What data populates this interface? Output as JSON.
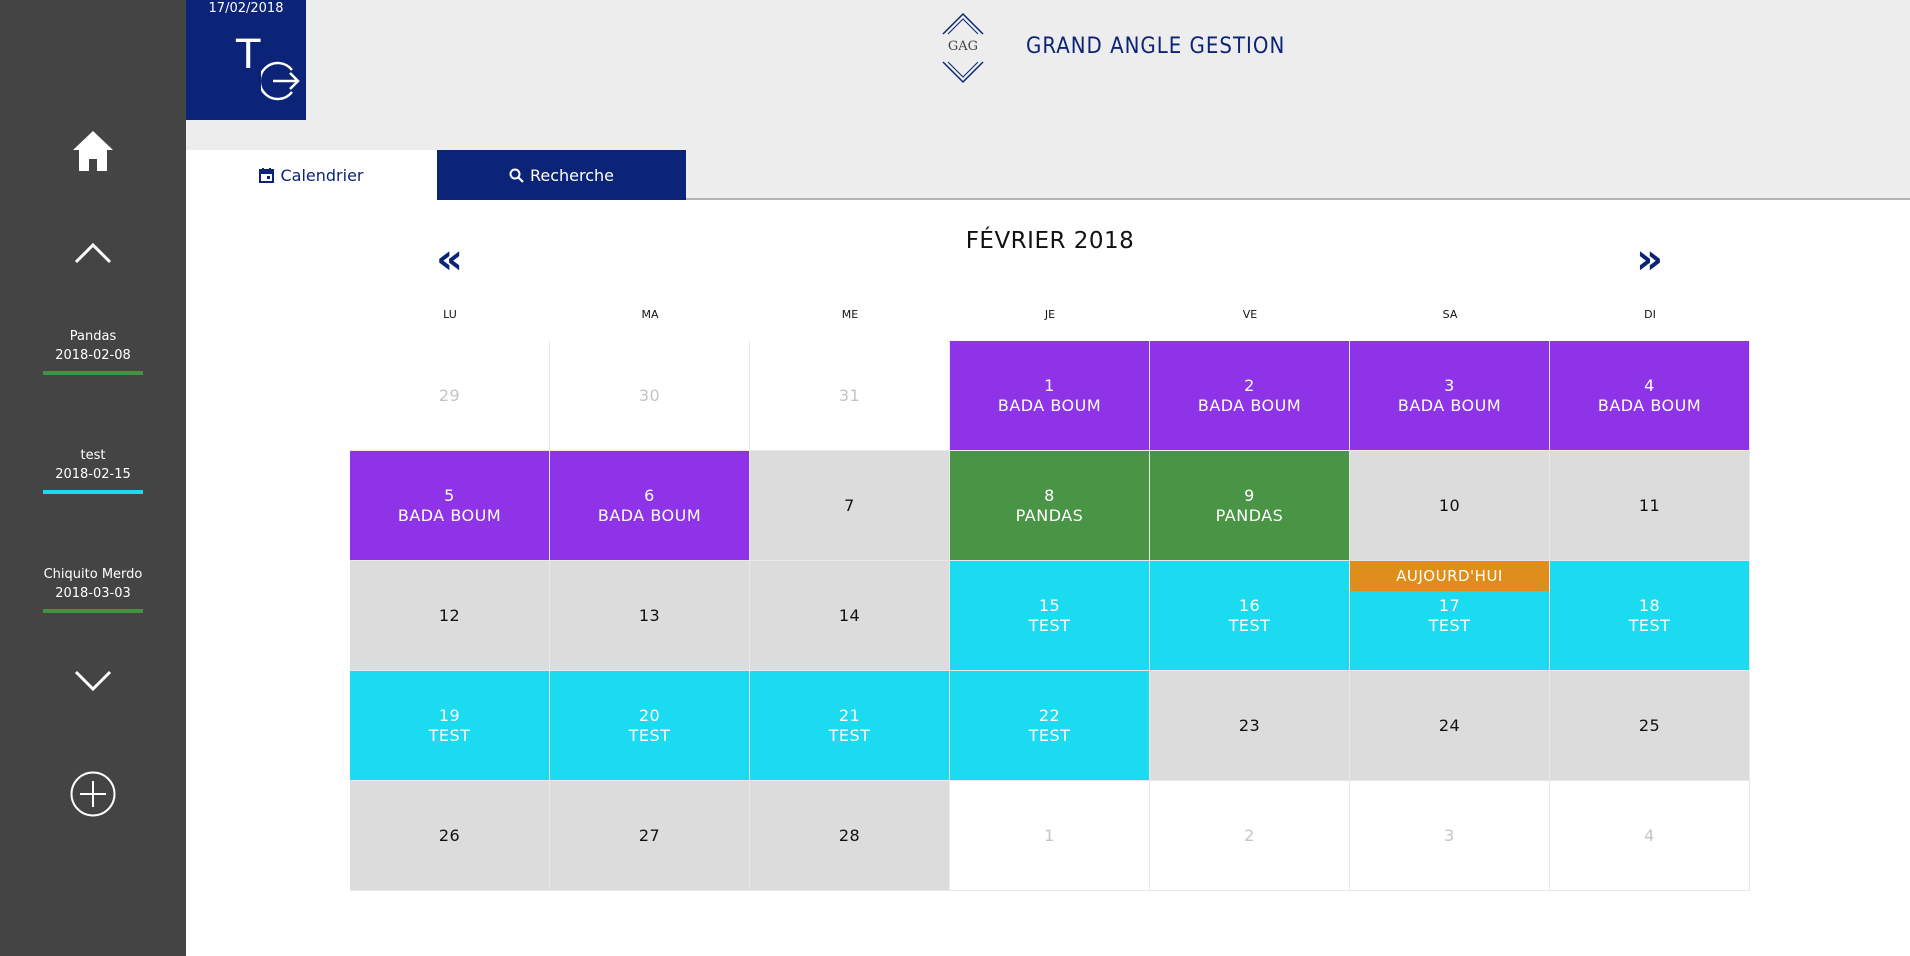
{
  "user": {
    "date": "17/02/2018",
    "initial": "T"
  },
  "brand": {
    "logo_text": "GAG",
    "title": "GRAND ANGLE GESTION"
  },
  "tabs": {
    "calendar": "Calendrier",
    "search": "Recherche"
  },
  "sidebar": {
    "projects": [
      {
        "name": "Pandas",
        "date": "2018-02-08",
        "color": "#43923f"
      },
      {
        "name": "test",
        "date": "2018-02-15",
        "color": "#1ad9f0"
      },
      {
        "name": "Chiquito Merdo",
        "date": "2018-03-03",
        "color": "#43923f"
      }
    ]
  },
  "calendar": {
    "title": "FÉVRIER 2018",
    "prev": "«",
    "next": "»",
    "today_label": "AUJOURD'HUI",
    "weekdays": [
      "LU",
      "MA",
      "ME",
      "JE",
      "VE",
      "SA",
      "DI"
    ],
    "event_colors": {
      "BADA BOUM": "#8f33e9",
      "PANDAS": "#4a9446",
      "TEST": "#1adbf0"
    },
    "cells": [
      {
        "day": "29",
        "outside": true
      },
      {
        "day": "30",
        "outside": true
      },
      {
        "day": "31",
        "outside": true
      },
      {
        "day": "1",
        "event": "BADA BOUM"
      },
      {
        "day": "2",
        "event": "BADA BOUM"
      },
      {
        "day": "3",
        "event": "BADA BOUM"
      },
      {
        "day": "4",
        "event": "BADA BOUM"
      },
      {
        "day": "5",
        "event": "BADA BOUM"
      },
      {
        "day": "6",
        "event": "BADA BOUM"
      },
      {
        "day": "7"
      },
      {
        "day": "8",
        "event": "PANDAS"
      },
      {
        "day": "9",
        "event": "PANDAS"
      },
      {
        "day": "10"
      },
      {
        "day": "11"
      },
      {
        "day": "12"
      },
      {
        "day": "13"
      },
      {
        "day": "14"
      },
      {
        "day": "15",
        "event": "TEST"
      },
      {
        "day": "16",
        "event": "TEST"
      },
      {
        "day": "17",
        "event": "TEST",
        "today": true
      },
      {
        "day": "18",
        "event": "TEST"
      },
      {
        "day": "19",
        "event": "TEST"
      },
      {
        "day": "20",
        "event": "TEST"
      },
      {
        "day": "21",
        "event": "TEST"
      },
      {
        "day": "22",
        "event": "TEST"
      },
      {
        "day": "23"
      },
      {
        "day": "24"
      },
      {
        "day": "25"
      },
      {
        "day": "26"
      },
      {
        "day": "27"
      },
      {
        "day": "28"
      },
      {
        "day": "1",
        "outside": true
      },
      {
        "day": "2",
        "outside": true
      },
      {
        "day": "3",
        "outside": true
      },
      {
        "day": "4",
        "outside": true
      }
    ]
  }
}
